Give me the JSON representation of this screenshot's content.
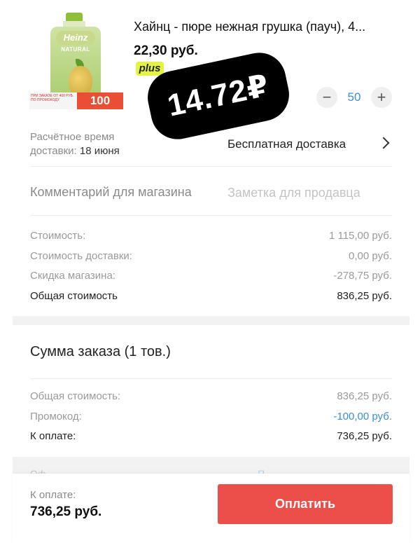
{
  "product": {
    "title": "Хайнц - пюре нежная грушка (пауч), 4...",
    "price": "22,30 руб.",
    "plus_badge": "plus",
    "thumbnail": {
      "brand": "Heinz",
      "line": "NATURAL",
      "promo_text": "ПРИ ЗАКАЗЕ ОТ 400 РУБ. ПО ПРОМОКОДУ",
      "promo_value": "100"
    },
    "quantity": "50",
    "minus_symbol": "−",
    "plus_symbol": "+"
  },
  "sticker": {
    "text": "14.72₽"
  },
  "delivery": {
    "label_line1": "Расчётное время",
    "label_line2": "доставки:",
    "date": "18 июня",
    "method": "Бесплатная доставка"
  },
  "comment": {
    "label": "Комментарий для магазина",
    "placeholder": "Заметка для продавца"
  },
  "costs": [
    {
      "label": "Стоимость:",
      "value": "1 115,00 руб."
    },
    {
      "label": "Стоимость доставки:",
      "value": "0,00 руб."
    },
    {
      "label": "Скидка магазина:",
      "value": "-278,75 руб."
    },
    {
      "label": "Общая стоимость",
      "value": "836,25 руб."
    }
  ],
  "summary": {
    "title": "Сумма заказа (1 тов.)",
    "rows": [
      {
        "label": "Общая стоимость:",
        "value": "836,25 руб."
      },
      {
        "label": "Промокод:",
        "value": "-100,00 руб."
      },
      {
        "label": "К оплате:",
        "value": "736,25 руб."
      }
    ]
  },
  "partial": {
    "left": "Оф...",
    "right": "П..."
  },
  "bottom": {
    "label": "К оплате:",
    "amount": "736,25 руб.",
    "button": "Оплатить"
  },
  "colors": {
    "accent": "#ec4f4a",
    "link": "#3b8fd0",
    "plus_badge": "#e3f542",
    "sticker": "#000000"
  }
}
